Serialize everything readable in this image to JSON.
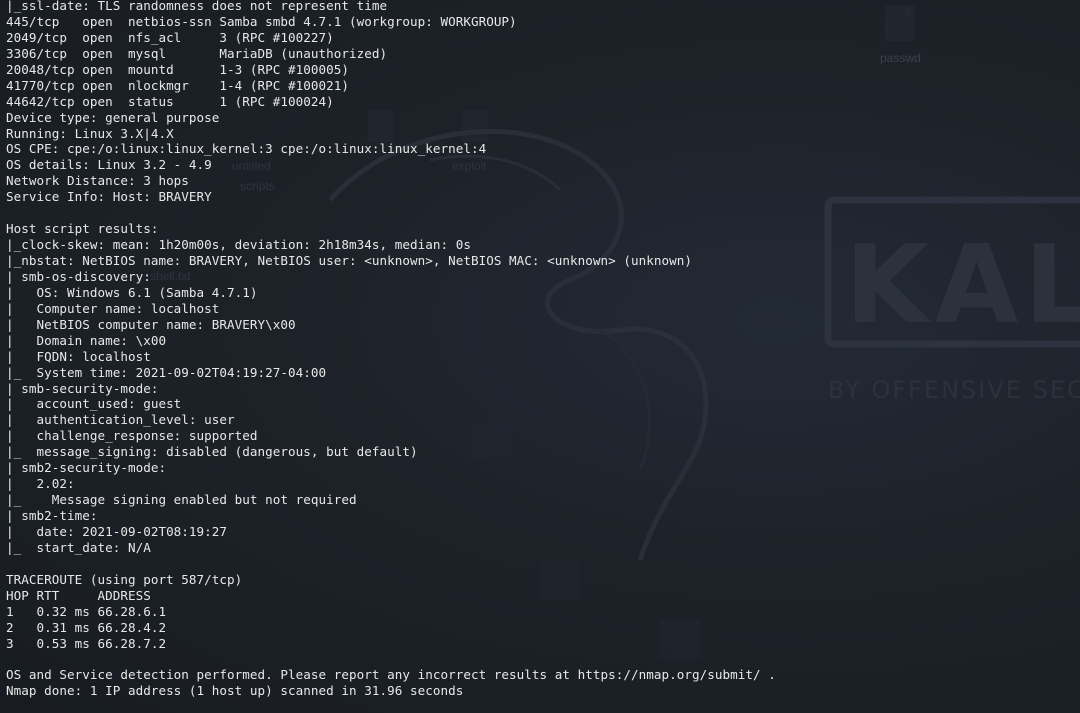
{
  "wallpaper": {
    "brand_text": "KAL",
    "tagline": "BY OFFENSIVE SEC",
    "desktop_labels": [
      "passwd",
      "untitled",
      "exploit",
      "scripts",
      "shell.txt"
    ],
    "colors": {
      "background": "#1c2028",
      "logo_stroke": "#2c333e",
      "logo_text": "#2b323c",
      "terminal_text": "#e8e8e8"
    }
  },
  "terminal": {
    "lines": [
      "|_ssl-date: TLS randomness does not represent time",
      "445/tcp   open  netbios-ssn Samba smbd 4.7.1 (workgroup: WORKGROUP)",
      "2049/tcp  open  nfs_acl     3 (RPC #100227)",
      "3306/tcp  open  mysql       MariaDB (unauthorized)",
      "20048/tcp open  mountd      1-3 (RPC #100005)",
      "41770/tcp open  nlockmgr    1-4 (RPC #100021)",
      "44642/tcp open  status      1 (RPC #100024)",
      "Device type: general purpose",
      "Running: Linux 3.X|4.X",
      "OS CPE: cpe:/o:linux:linux_kernel:3 cpe:/o:linux:linux_kernel:4",
      "OS details: Linux 3.2 - 4.9",
      "Network Distance: 3 hops",
      "Service Info: Host: BRAVERY",
      "",
      "Host script results:",
      "|_clock-skew: mean: 1h20m00s, deviation: 2h18m34s, median: 0s",
      "|_nbstat: NetBIOS name: BRAVERY, NetBIOS user: <unknown>, NetBIOS MAC: <unknown> (unknown)",
      "| smb-os-discovery:",
      "|   OS: Windows 6.1 (Samba 4.7.1)",
      "|   Computer name: localhost",
      "|   NetBIOS computer name: BRAVERY\\x00",
      "|   Domain name: \\x00",
      "|   FQDN: localhost",
      "|_  System time: 2021-09-02T04:19:27-04:00",
      "| smb-security-mode:",
      "|   account_used: guest",
      "|   authentication_level: user",
      "|   challenge_response: supported",
      "|_  message_signing: disabled (dangerous, but default)",
      "| smb2-security-mode:",
      "|   2.02:",
      "|_    Message signing enabled but not required",
      "| smb2-time:",
      "|   date: 2021-09-02T08:19:27",
      "|_  start_date: N/A",
      "",
      "TRACEROUTE (using port 587/tcp)",
      "HOP RTT     ADDRESS",
      "1   0.32 ms 66.28.6.1",
      "2   0.31 ms 66.28.4.2",
      "3   0.53 ms 66.28.7.2",
      "",
      "OS and Service detection performed. Please report any incorrect results at https://nmap.org/submit/ .",
      "Nmap done: 1 IP address (1 host up) scanned in 31.96 seconds"
    ]
  }
}
